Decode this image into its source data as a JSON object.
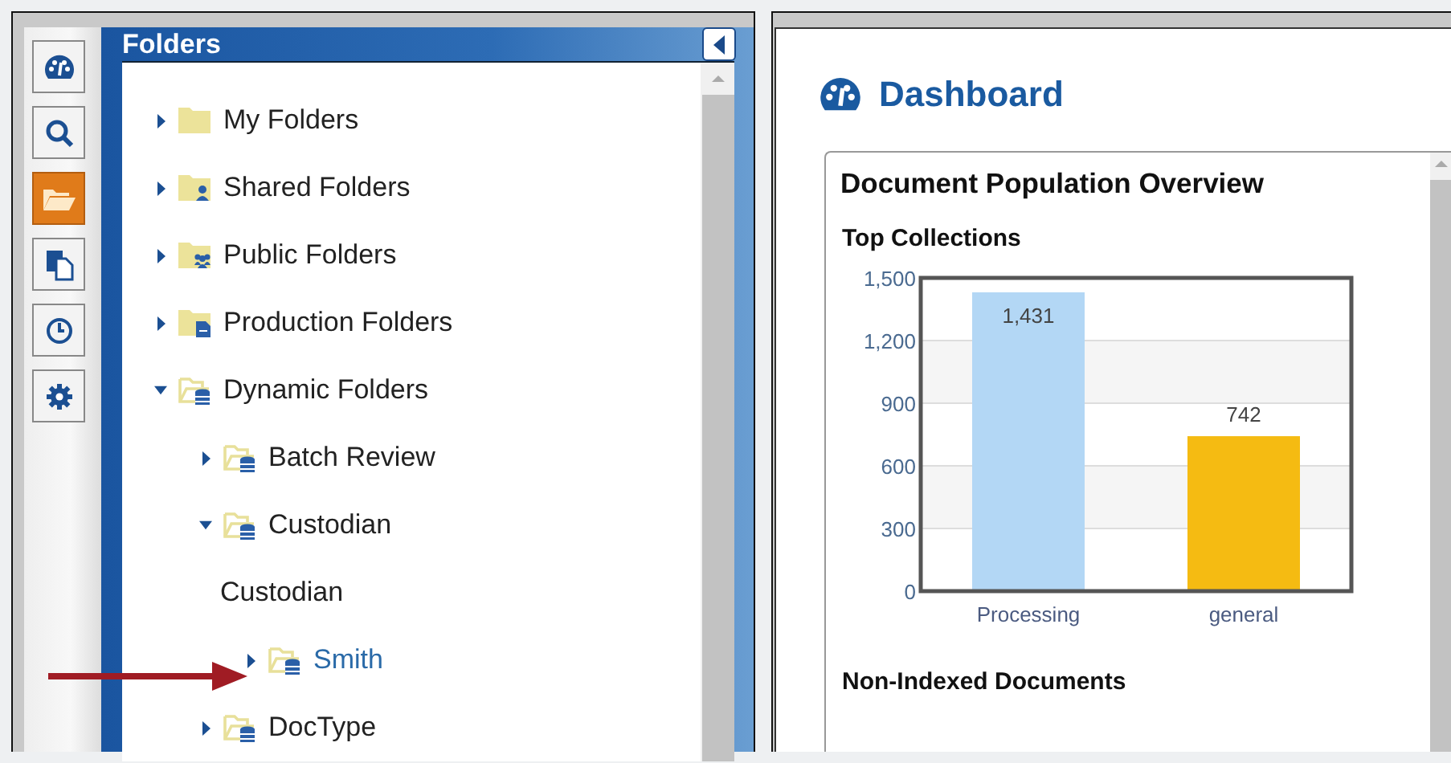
{
  "rail": [
    {
      "kind": "dashboard",
      "selected": false
    },
    {
      "kind": "search",
      "selected": false
    },
    {
      "kind": "folders",
      "selected": true
    },
    {
      "kind": "documents",
      "selected": false
    },
    {
      "kind": "history",
      "selected": false
    },
    {
      "kind": "settings",
      "selected": false
    }
  ],
  "sidebar": {
    "title": "Folders",
    "tree": [
      {
        "kind": "folder",
        "label": "My Folders",
        "expanded": false,
        "selected": false
      },
      {
        "kind": "shared",
        "label": "Shared Folders",
        "expanded": false,
        "selected": false
      },
      {
        "kind": "public",
        "label": "Public Folders",
        "expanded": false,
        "selected": false
      },
      {
        "kind": "production",
        "label": "Production Folders",
        "expanded": false,
        "selected": false
      },
      {
        "kind": "dynamic",
        "label": "Dynamic Folders",
        "expanded": true,
        "selected": false,
        "children": [
          {
            "kind": "dynamic",
            "label": "Batch Review",
            "expanded": false,
            "selected": false
          },
          {
            "kind": "dynamic",
            "label": "Custodian",
            "expanded": true,
            "selected": false,
            "children": [
              {
                "kind": "heading",
                "label": "Custodian"
              },
              {
                "kind": "dynamic",
                "label": "Smith",
                "expanded": false,
                "selected": true
              }
            ]
          },
          {
            "kind": "dynamic",
            "label": "DocType",
            "expanded": false,
            "selected": false
          }
        ]
      }
    ]
  },
  "dashboard": {
    "title": "Dashboard",
    "card": {
      "title": "Document Population Overview",
      "section": "Top Collections",
      "chart_data": {
        "type": "bar",
        "categories": [
          "Processing",
          "general"
        ],
        "values": [
          1431,
          742
        ],
        "colors": [
          "#b3d7f5",
          "#f5bb12"
        ],
        "ylim": [
          0,
          1500
        ],
        "grid": true,
        "yticks": [
          0,
          {
            "value": 300,
            "label": "300"
          },
          {
            "value": 600,
            "label": "600"
          },
          {
            "value": 900,
            "label": "900"
          },
          {
            "value": 1200,
            "label": "1,200"
          },
          {
            "value": 1500,
            "label": "1,500"
          }
        ],
        "value_labels": [
          "1,431",
          "742"
        ]
      },
      "next_section": "Non-Indexed Documents"
    }
  }
}
